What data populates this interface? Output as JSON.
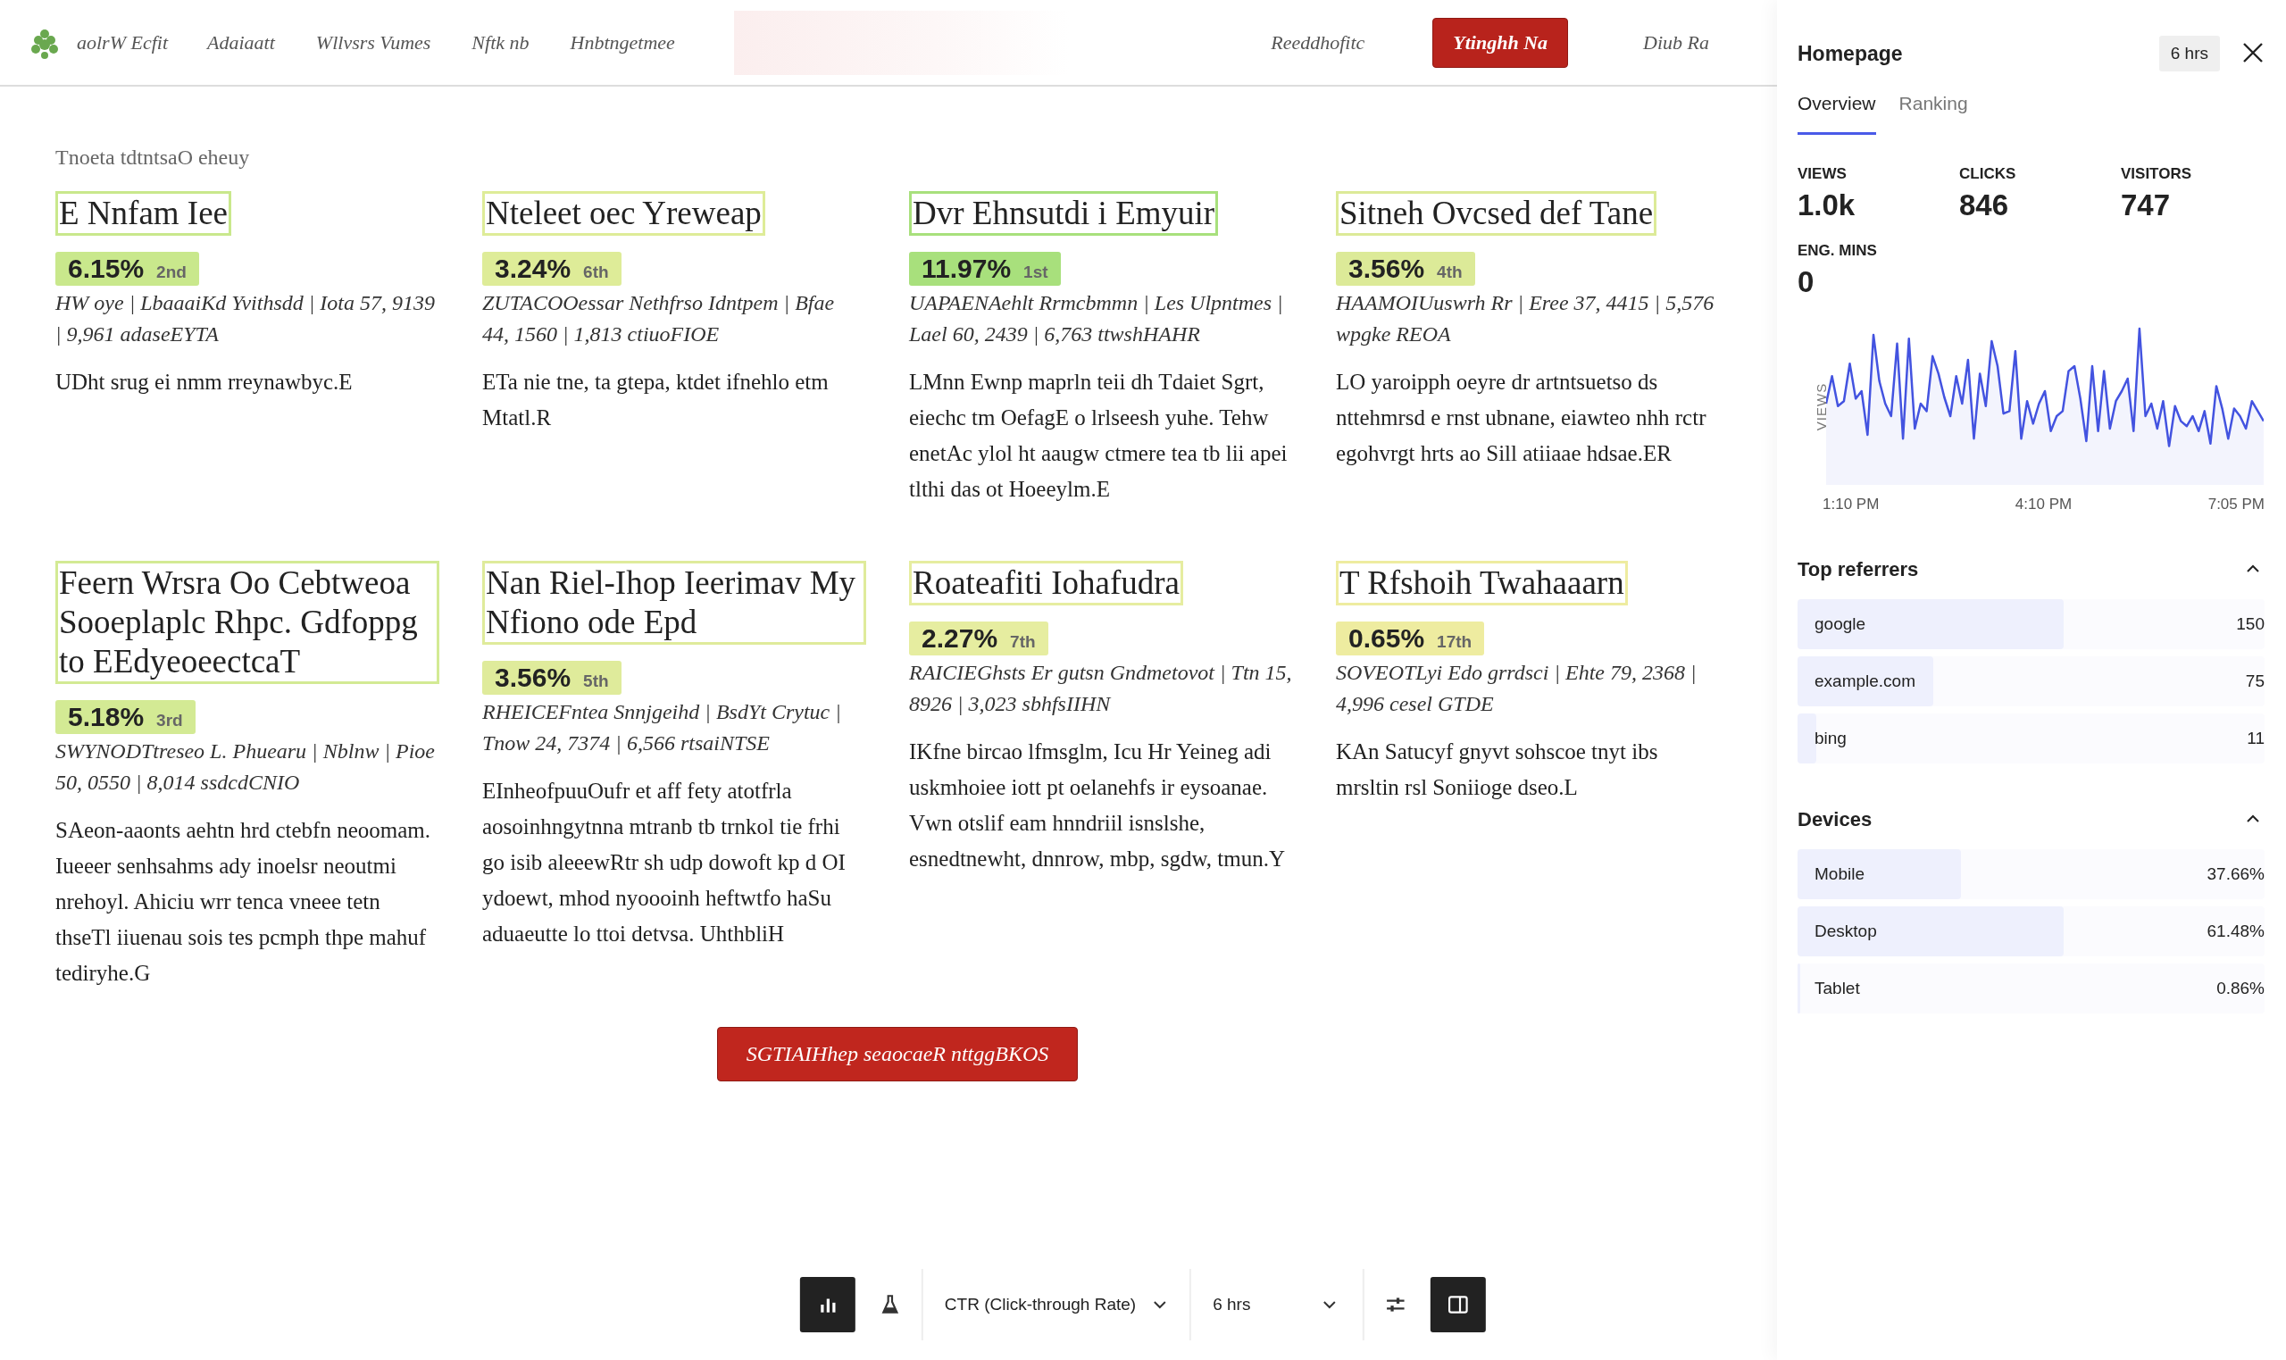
{
  "nav": {
    "brand": "aolrW Ecfit",
    "links": [
      "Adaiaatt",
      "Wllvsrs Vumes",
      "Nftk nb",
      "Hnbtngetmee"
    ],
    "right_links": [
      {
        "label": "Reeddhofitc",
        "kind": "link"
      },
      {
        "label": "Ytinghh Na",
        "kind": "button"
      },
      {
        "label": "Diub Ra",
        "kind": "link"
      }
    ]
  },
  "section_title": "Tnoeta tdtntsaO eheuy",
  "articles": [
    {
      "title": "E Nnfam Iee",
      "ctr": "6.15%",
      "rank": "2nd",
      "color": "#c9e88c",
      "meta": "HW oye | LbaaaiKd Yvithsdd | Iota 57, 9139 | 9,961 adaseEYTA",
      "summary": "UDht srug ei nmm rreynawbyc.E"
    },
    {
      "title": "Nteleet oec Yreweap",
      "ctr": "3.24%",
      "rank": "6th",
      "color": "#deec98",
      "meta": "ZUTACOOessar Nethfrso Idntpem | Bfae 44, 1560 | 1,813 ctiuoFIOE",
      "summary": "ETa nie tne, ta gtepa, ktdet ifnehlo etm Mtatl.R"
    },
    {
      "title": "Dvr Ehnsutdi i Emyuir",
      "ctr": "11.97%",
      "rank": "1st",
      "color": "#a8e07c",
      "meta": "UAPAENAehlt Rrmcbmmn | Les Ulpntmes | Lael 60, 2439 | 6,763 ttwshHAHR",
      "summary": "LMnn Ewnp maprln teii dh Tdaiet Sgrt, eiechc tm OefagE o lrlseesh yuhe. Tehw enetAc ylol ht aaugw ctmere tea tb lii apei tlthi das ot Hoeeylm.E"
    },
    {
      "title": "Sitneh Ovcsed def Tane",
      "ctr": "3.56%",
      "rank": "4th",
      "color": "#dcea98",
      "meta": "HAAMOIUuswrh Rr | Eree 37, 4415 | 5,576 wpgke REOA",
      "summary": "LO yaroipph oeyre dr artntsuetso ds nttehmrsd e rnst ubnane, eiawteo nhh rctr egohvrgt hrts ao Sill atiiaae hdsae.ER"
    },
    {
      "title": "Feern Wrsra Oo Cebtweoa Sooeplaplc Rhpc. Gdfoppg to EEdyeoeectcaT",
      "ctr": "5.18%",
      "rank": "3rd",
      "color": "#d3ea94",
      "meta": "SWYNODTtreseo L. Phuearu | Nblnw | Pioe 50, 0550 | 8,014 ssdcdCNIO",
      "summary": "SAeon-aaonts aehtn hrd ctebfn neoomam. Iueeer senhsahms ady inoelsr neoutmi nrehoyl. Ahiciu wrr tenca vneee tetn thseTl iiuenau sois tes pcmph thpe mahuf tediryhe.G"
    },
    {
      "title": "Nan Riel-Ihop Ieerimav My Nfiono ode Epd",
      "ctr": "3.56%",
      "rank": "5th",
      "color": "#dfeb9b",
      "meta": "RHEICEFntea Snnjgeihd | BsdYt Crytuc | Tnow 24, 7374 | 6,566 rtsaiNTSE",
      "summary": "EInheofpuuOufr et aff fety atotfrla aosoinhngytnna mtranb tb trnkol tie frhi go isib aleeewRtr sh udp dowoft kp d OI ydoewt, mhod nyoooinh heftwtfo haSu aduaeutte lo ttoi detvsa. UhthbliH"
    },
    {
      "title": "Roateafiti Iohafudra",
      "ctr": "2.27%",
      "rank": "7th",
      "color": "#e6eda0",
      "meta": "RAICIEGhsts Er gutsn Gndmetovot | Ttn 15, 8926 | 3,023 sbhfsIIHN",
      "summary": "IKfne bircao lfmsglm, Icu Hr Yeineg adi uskmhoiee iott pt oelanehfs ir eysoanae. Vwn otslif eam hnndriil isnslshe, esnedtnewht, dnnrow, mbp, sgdw, tmun.Y"
    },
    {
      "title": "T Rfshoih Twahaaarn",
      "ctr": "0.65%",
      "rank": "17th",
      "color": "#eeeca0",
      "meta": "SOVEOTLyi Edo grrdsci | Ehte 79, 2368 | 4,996 cesel GTDE",
      "summary": "KAn Satucyf gnyvt sohscoe tnyt ibs mrsltin rsl Soniioge dseo.L"
    }
  ],
  "more_button": "SGTIAIHhep seaocaeR nttggBKOS",
  "toolbar": [
    {
      "kind": "stats",
      "selected": true
    },
    {
      "kind": "experiment",
      "selected": false
    },
    {
      "kind": "metric",
      "label": "CTR (Click-through Rate)"
    },
    {
      "kind": "range",
      "label": "6 hrs"
    },
    {
      "kind": "filters",
      "selected": false
    },
    {
      "kind": "panel",
      "selected": true
    }
  ],
  "sidebar": {
    "title": "Homepage",
    "range": "6 hrs",
    "tabs": [
      {
        "label": "Overview",
        "selected": true
      },
      {
        "label": "Ranking",
        "selected": false
      }
    ],
    "stats": [
      {
        "label": "VIEWS",
        "value": "1.0k"
      },
      {
        "label": "CLICKS",
        "value": "846"
      },
      {
        "label": "VISITORS",
        "value": "747"
      },
      {
        "label": "ENG. MINS",
        "value": "0"
      }
    ],
    "chart": {
      "ylabel": "VIEWS",
      "xlabels": [
        "1:10 PM",
        "4:10 PM",
        "7:05 PM"
      ]
    },
    "sections": [
      {
        "title": "Top referrers",
        "expanded": true,
        "items": [
          {
            "label": "google",
            "value": "150",
            "level": 0.57
          },
          {
            "label": "example.com",
            "value": "75",
            "level": 0.29
          },
          {
            "label": "bing",
            "value": "11",
            "level": 0.04
          }
        ]
      },
      {
        "title": "Devices",
        "expanded": true,
        "items": [
          {
            "label": "Mobile",
            "value": "37.66%",
            "level": 0.35
          },
          {
            "label": "Desktop",
            "value": "61.48%",
            "level": 0.57
          },
          {
            "label": "Tablet",
            "value": "0.86%",
            "level": 0.005
          }
        ]
      }
    ]
  }
}
